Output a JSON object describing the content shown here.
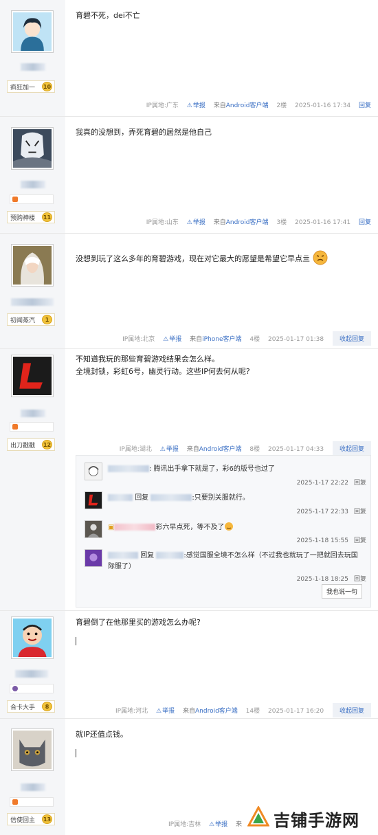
{
  "posts": [
    {
      "level_title": "疯狂加一",
      "level": "10",
      "content": [
        "育碧不死，dei不亡"
      ],
      "ip": "IP属地:广东",
      "report": "举报",
      "source_prefix": "来自",
      "source": "Android客户端",
      "floor": "2楼",
      "time": "2025-01-16 17:34",
      "reply": "回复"
    },
    {
      "level_title": "预购神楼",
      "level": "11",
      "content": [
        "我真的没想到，弄死育碧的居然是他自己"
      ],
      "ip": "IP属地:山东",
      "report": "举报",
      "source_prefix": "来自",
      "source": "Android客户端",
      "floor": "3楼",
      "time": "2025-01-16 17:41",
      "reply": "回复"
    },
    {
      "level_title": "初闻蒸汽",
      "level": "1",
      "content": [
        "没想到玩了这么多年的育碧游戏，现在对它最大的愿望是希望它早点亖"
      ],
      "ip": "IP属地:北京",
      "report": "举报",
      "source_prefix": "来自",
      "source": "iPhone客户端",
      "floor": "4楼",
      "time": "2025-01-17 01:38",
      "reply": "收起回复"
    },
    {
      "level_title": "出刀戳戳",
      "level": "12",
      "content": [
        "不知道我玩的那些育碧游戏结果会怎么样。",
        "全境封锁，彩虹6号，幽灵行动。这些IP何去何从呢?"
      ],
      "ip": "IP属地:湖北",
      "report": "举报",
      "source_prefix": "来自",
      "source": "Android客户端",
      "floor": "8楼",
      "time": "2025-01-17 04:33",
      "reply": "收起回复"
    },
    {
      "level_title": "合卡大手",
      "level": "8",
      "content": [
        "育碧倒了在他那里买的游戏怎么办呢?"
      ],
      "ip": "IP属地:河北",
      "report": "举报",
      "source_prefix": "来自",
      "source": "Android客户端",
      "floor": "14楼",
      "time": "2025-01-17 16:20",
      "reply": "收起回复"
    },
    {
      "level_title": "信使回主",
      "level": "13",
      "content": [
        "就IP还值点钱。"
      ],
      "ip": "IP属地:吉林",
      "report": "举报",
      "source_prefix": "来",
      "source": "",
      "floor": "",
      "time": "",
      "reply": ""
    }
  ],
  "lzl": {
    "items": [
      {
        "text": ": 腾讯出手拿下就是了，彩6的版号也过了",
        "reply_word": "",
        "time": "2025-1-17 22:22",
        "reply": "回复"
      },
      {
        "text": ":只要别关服就行。",
        "reply_word": "回复",
        "time": "2025-1-17 22:33",
        "reply": "回复"
      },
      {
        "text": "彩六早点死，等不及了",
        "reply_word": "",
        "time": "2025-1-18 15:55",
        "reply": "回复"
      },
      {
        "text": ":感觉国服全境不怎么样（不过我也就玩了一把就回去玩国际服了）",
        "reply_word": "回复",
        "time": "2025-1-18 18:25",
        "reply": "回复"
      }
    ],
    "say_button": "我也说一句"
  },
  "watermark": {
    "text": "吉铺手游网"
  },
  "colors": {
    "link": "#3a6fc4",
    "sidebar": "#f5f6f8",
    "badge": "#f2c33a"
  }
}
